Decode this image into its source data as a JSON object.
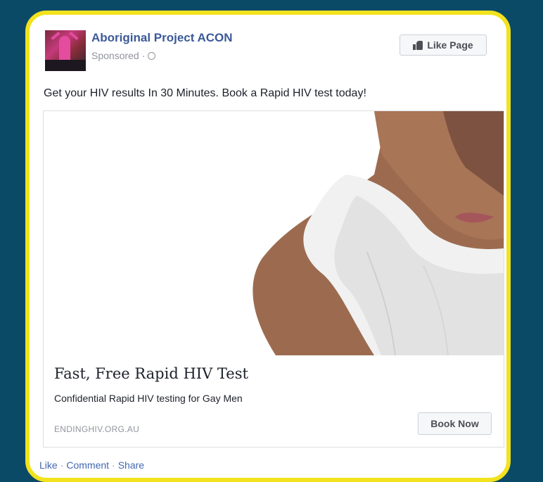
{
  "post": {
    "page_name": "Aboriginal Project ACON",
    "sponsored_label": "Sponsored",
    "sponsored_separator": "·",
    "like_page_label": "Like Page",
    "text": "Get your HIV results In 30 Minutes. Book a Rapid HIV test today!"
  },
  "ad": {
    "title": "Fast, Free Rapid HIV Test",
    "description": "Confidential Rapid HIV testing for Gay Men",
    "domain": "ENDINGHIV.ORG.AU",
    "cta_label": "Book Now"
  },
  "actions": {
    "like": "Like",
    "comment": "Comment",
    "share": "Share",
    "separator": "·"
  },
  "colors": {
    "background": "#0b4a67",
    "frame": "#f2e21e",
    "link": "#3b5998",
    "muted": "#90949c"
  },
  "icons": [
    "globe-icon",
    "thumbs-up-icon"
  ]
}
